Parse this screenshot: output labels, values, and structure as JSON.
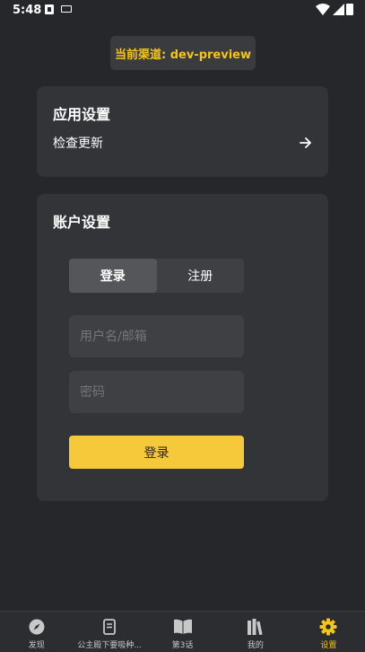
{
  "status_bar": {
    "time": "5:48"
  },
  "channel": {
    "text": "当前渠道: dev-preview"
  },
  "app_settings": {
    "title": "应用设置",
    "check_update_label": "检查更新"
  },
  "account_settings": {
    "title": "账户设置",
    "tabs": [
      {
        "label": "登录",
        "active": true
      },
      {
        "label": "注册",
        "active": false
      }
    ],
    "username_placeholder": "用户名/邮箱",
    "password_placeholder": "密码",
    "login_button": "登录"
  },
  "bottom_nav": {
    "items": [
      {
        "label": "发现",
        "icon": "compass-icon"
      },
      {
        "label": "公主殿下要吸种...",
        "icon": "document-icon"
      },
      {
        "label": "第3话",
        "icon": "open-book-icon"
      },
      {
        "label": "我的",
        "icon": "bookshelf-icon"
      },
      {
        "label": "设置",
        "icon": "gear-icon",
        "active": true
      }
    ]
  },
  "colors": {
    "accent": "#f5c518",
    "background": "#25272b",
    "card": "#333437",
    "button": "#f5c93a"
  }
}
